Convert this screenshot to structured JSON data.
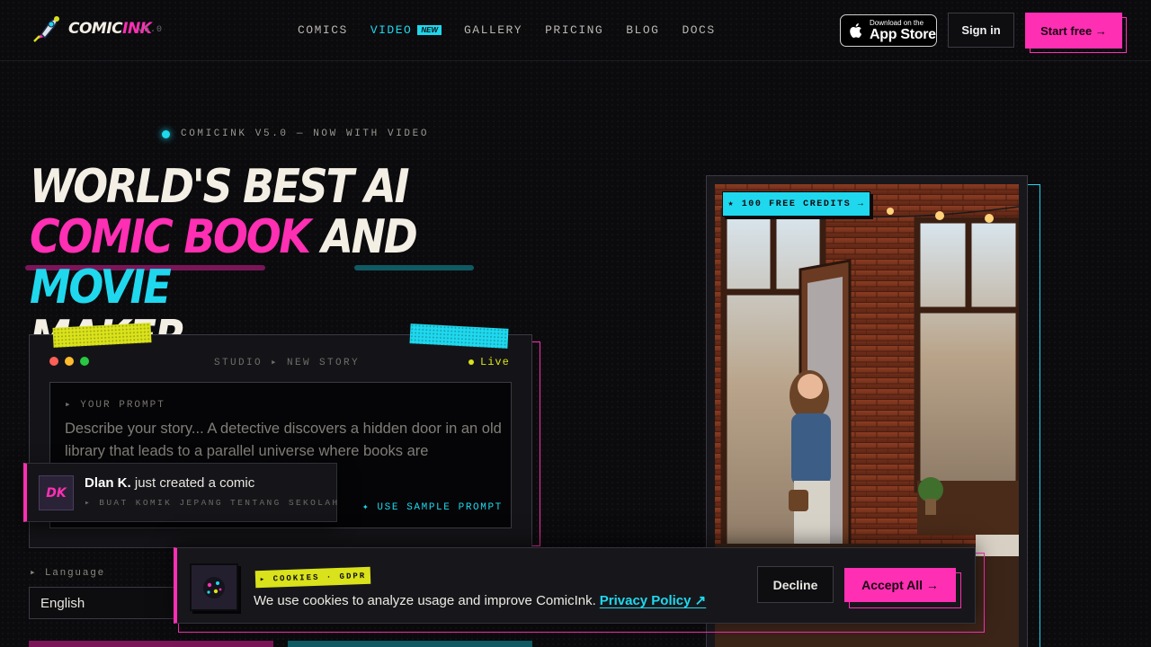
{
  "nav": {
    "logo_word_a": "COMIC",
    "logo_word_b": "INK",
    "version": "v5.0",
    "menu": [
      {
        "label": "COMICS",
        "active": false
      },
      {
        "label": "VIDEO",
        "active": true,
        "badge": "NEW"
      },
      {
        "label": "GALLERY",
        "active": false
      },
      {
        "label": "PRICING",
        "active": false
      },
      {
        "label": "BLOG",
        "active": false
      },
      {
        "label": "DOCS",
        "active": false
      }
    ],
    "appstore_small": "Download on the",
    "appstore_big": "App Store",
    "signin": "Sign in",
    "start_free": "Start free →"
  },
  "hero": {
    "kicker": "COMICINK V5.0 — NOW WITH VIDEO",
    "line1": "WORLD'S BEST AI",
    "pink": "COMIC BOOK",
    "and": "AND",
    "cyan": "MOVIE",
    "line3": "MAKER"
  },
  "studio": {
    "title": "STUDIO ▸ NEW STORY",
    "live": "Live",
    "prompt_label": "▸ YOUR PROMPT",
    "prompt_placeholder": "Describe your story... A detective discovers a hidden door in an old library that leads to a parallel universe where books are",
    "sample": "✦ USE SAMPLE PROMPT"
  },
  "toast": {
    "initials": "DK",
    "name": "Dlan K.",
    "action": "just created a comic",
    "sub": "▸ BUAT KOMIK JEPANG TENTANG SEKOLAH"
  },
  "language": {
    "label": "▸ Language",
    "selected": "English"
  },
  "showcase": {
    "credits": "★ 100 FREE CREDITS →"
  },
  "cookie": {
    "tag": "▸ COOKIES · GDPR",
    "text": "We use cookies to analyze usage and improve ComicInk.",
    "link": "Privacy Policy ↗",
    "decline": "Decline",
    "accept": "Accept All →"
  },
  "colors": {
    "accent_pink": "#ff2fb3",
    "accent_cyan": "#1fd8ee",
    "accent_yellow": "#d9e21a",
    "background": "#0b0b0e"
  }
}
